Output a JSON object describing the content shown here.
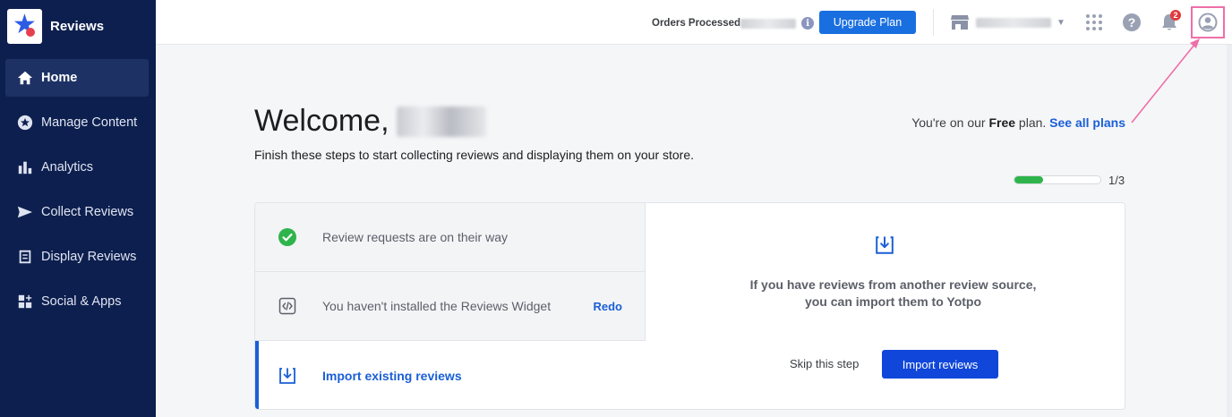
{
  "sidebar": {
    "brand": "Reviews",
    "items": [
      {
        "label": "Home",
        "icon": "home-icon"
      },
      {
        "label": "Manage Content",
        "icon": "star-circle-icon"
      },
      {
        "label": "Analytics",
        "icon": "bar-chart-icon"
      },
      {
        "label": "Collect Reviews",
        "icon": "send-icon"
      },
      {
        "label": "Display Reviews",
        "icon": "document-icon"
      },
      {
        "label": "Social & Apps",
        "icon": "apps-plus-icon"
      }
    ]
  },
  "topbar": {
    "orders_label": "Orders Processed",
    "upgrade_label": "Upgrade Plan",
    "notification_count": "2"
  },
  "main": {
    "welcome": "Welcome,",
    "subtitle": "Finish these steps to start collecting reviews and displaying them on your store.",
    "plan_prefix": "You're on our ",
    "plan_name": "Free",
    "plan_suffix": " plan. ",
    "plan_link": "See all plans",
    "progress_label": "1/3",
    "progress_fraction": 0.33
  },
  "steps": [
    {
      "label": "Review requests are on their way",
      "status": "done"
    },
    {
      "label": "You haven't installed the Reviews Widget",
      "action": "Redo"
    },
    {
      "label": "Import existing reviews",
      "status": "active"
    }
  ],
  "detail": {
    "line1": "If you have reviews from another review source,",
    "line2": "you can import them to Yotpo",
    "skip_label": "Skip this step",
    "import_label": "Import reviews"
  },
  "colors": {
    "sidebar_bg": "#0d1f4e",
    "accent": "#1a5fd6",
    "success": "#2fb44c",
    "annotation": "#ef6fa8"
  }
}
